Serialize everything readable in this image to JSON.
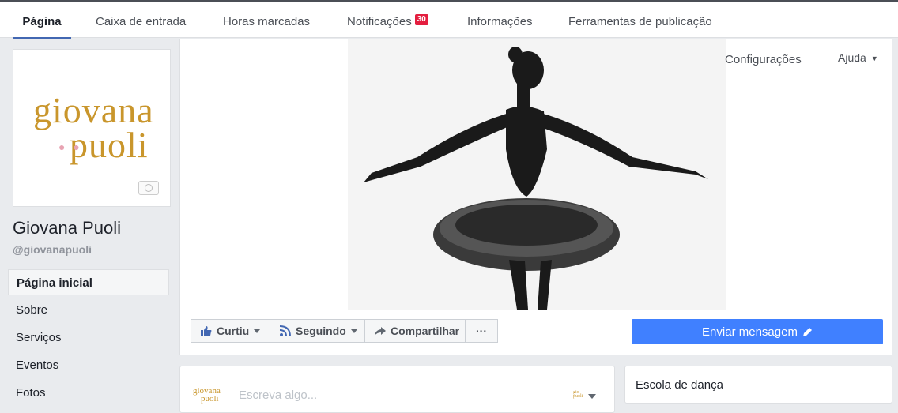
{
  "tabs": [
    {
      "label": "Página",
      "active": true
    },
    {
      "label": "Caixa de entrada"
    },
    {
      "label": "Horas marcadas"
    },
    {
      "label": "Notificações",
      "badge": "30"
    },
    {
      "label": "Informações"
    },
    {
      "label": "Ferramentas de publicação"
    }
  ],
  "profile": {
    "logo_line1": "giovana",
    "logo_line2": "puoli",
    "name": "Giovana Puoli",
    "handle": "@giovanapuoli"
  },
  "nav": [
    {
      "label": "Página inicial",
      "active": true
    },
    {
      "label": "Sobre"
    },
    {
      "label": "Serviços"
    },
    {
      "label": "Eventos"
    },
    {
      "label": "Fotos"
    }
  ],
  "cover": {
    "settings_label": "Configurações",
    "help_label": "Ajuda"
  },
  "actions": {
    "like": "Curtiu",
    "follow": "Seguindo",
    "share": "Compartilhar",
    "more": "···",
    "send_message": "Enviar mensagem"
  },
  "composer": {
    "placeholder": "Escreva algo...",
    "logo_line1": "giovana",
    "logo_line2": "puoli"
  },
  "info": {
    "category": "Escola de dança"
  },
  "colors": {
    "accent": "#4267b2",
    "send_button": "#4080ff",
    "logo_gold": "#c9962c",
    "badge_red": "#e41e3f"
  }
}
